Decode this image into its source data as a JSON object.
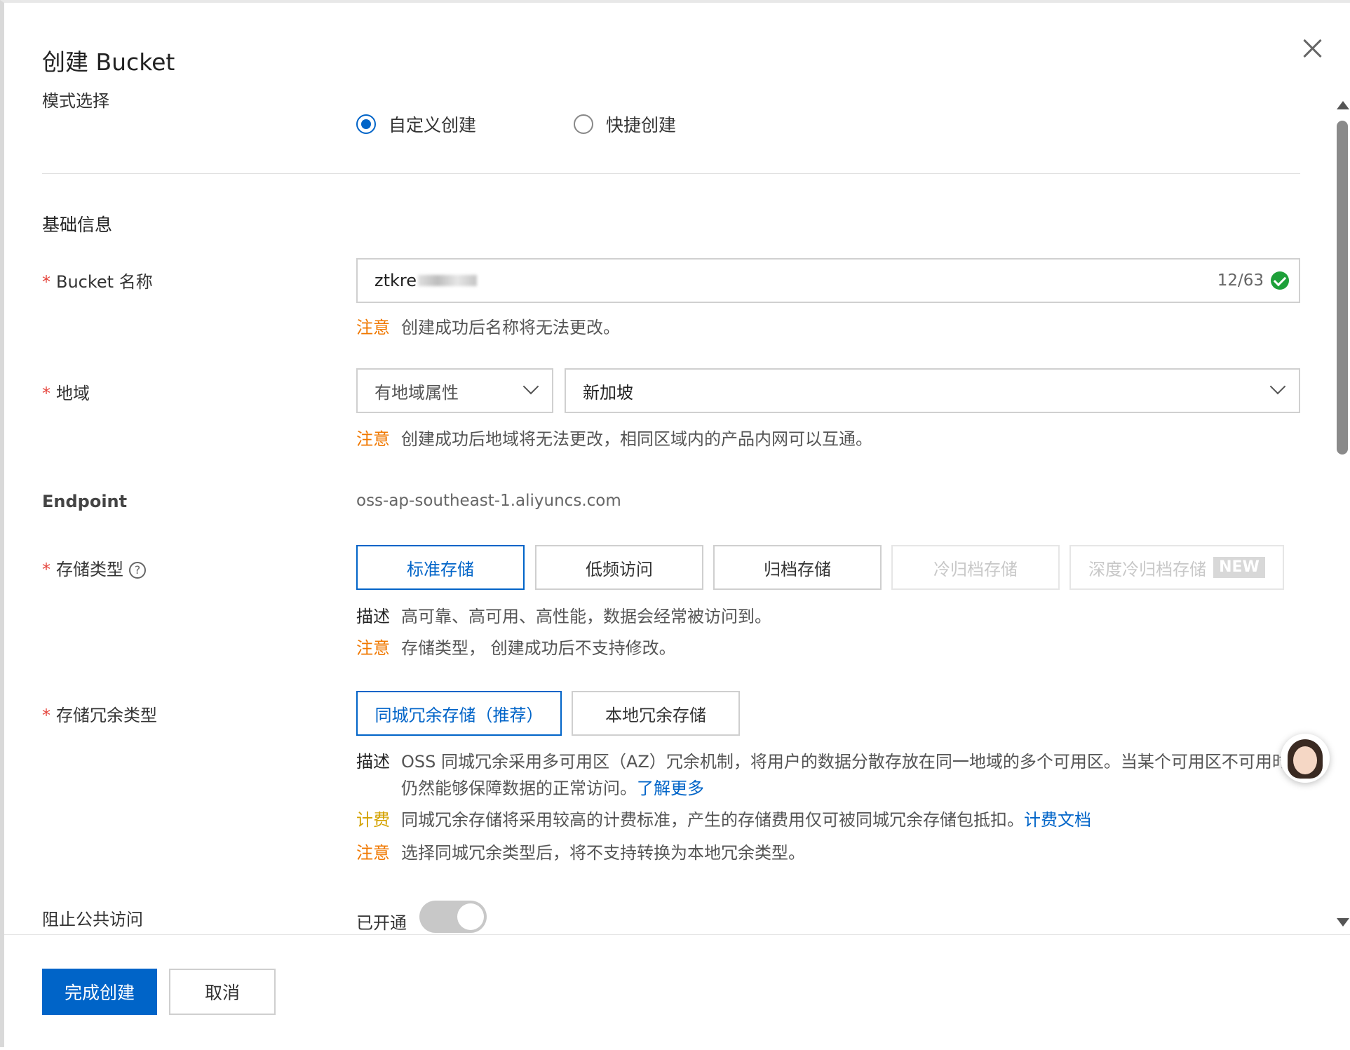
{
  "dialog": {
    "title": "创建 Bucket"
  },
  "mode": {
    "label": "模式选择",
    "options": [
      {
        "label": "自定义创建",
        "checked": true
      },
      {
        "label": "快捷创建",
        "checked": false
      }
    ]
  },
  "basic_info": {
    "section_title": "基础信息"
  },
  "bucket_name": {
    "label": "Bucket 名称",
    "value": "ztkre",
    "counter": "12/63",
    "note_tag": "注意",
    "note_text": "创建成功后名称将无法更改。"
  },
  "region": {
    "label": "地域",
    "attribute_select": "有地域属性",
    "region_select": "新加坡",
    "note_tag": "注意",
    "note_text": "创建成功后地域将无法更改，相同区域内的产品内网可以互通。"
  },
  "endpoint": {
    "label": "Endpoint",
    "value": "oss-ap-southeast-1.aliyuncs.com"
  },
  "storage_class": {
    "label": "存储类型",
    "help_icon": "?",
    "options": [
      {
        "label": "标准存储",
        "state": "selected"
      },
      {
        "label": "低频访问",
        "state": "normal"
      },
      {
        "label": "归档存储",
        "state": "normal"
      },
      {
        "label": "冷归档存储",
        "state": "disabled"
      },
      {
        "label": "深度冷归档存储",
        "state": "disabled",
        "badge": "NEW"
      }
    ],
    "desc_tag": "描述",
    "desc_text": "高可靠、高可用、高性能，数据会经常被访问到。",
    "note_tag": "注意",
    "note_text": "存储类型， 创建成功后不支持修改。"
  },
  "redundancy": {
    "label": "存储冗余类型",
    "options": [
      {
        "label": "同城冗余存储（推荐）",
        "state": "selected"
      },
      {
        "label": "本地冗余存储",
        "state": "normal"
      }
    ],
    "desc_tag": "描述",
    "desc_text_line1": "OSS 同城冗余采用多可用区（AZ）冗余机制，将用户的数据分散存放在同一地域的多个可用区。当某个可用区不可用时",
    "desc_text_line2": "仍然能够保障数据的正常访问。",
    "desc_link": "了解更多",
    "fee_tag": "计费",
    "fee_text": "同城冗余存储将采用较高的计费标准，产生的存储费用仅可被同城冗余存储包抵扣。",
    "fee_link": "计费文档",
    "note_tag": "注意",
    "note_text": "选择同城冗余类型后，将不支持转换为本地冗余类型。"
  },
  "public_access": {
    "label": "阻止公共访问",
    "status": "已开通"
  },
  "footer": {
    "confirm_label": "完成创建",
    "cancel_label": "取消"
  },
  "colors": {
    "primary": "#0064c8",
    "required": "#e5443c",
    "warning": "#f07800",
    "fee": "#d4a200",
    "success": "#1ea03a"
  }
}
